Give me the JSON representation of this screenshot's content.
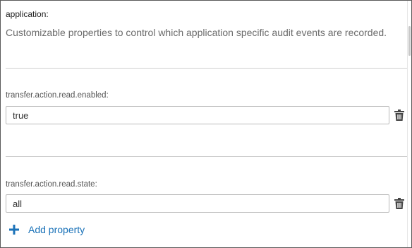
{
  "section": {
    "label": "application:",
    "description": "Customizable properties to control which application specific audit events are recorded."
  },
  "properties": [
    {
      "label": "transfer.action.read.enabled:",
      "value": "true"
    },
    {
      "label": "transfer.action.read.state:",
      "value": "all"
    }
  ],
  "actions": {
    "add_property_label": "Add property"
  },
  "icons": {
    "delete": "trash-icon",
    "add": "plus-icon"
  },
  "colors": {
    "link": "#1a72b8",
    "text": "#3a3a3a",
    "muted": "#6b6b6b",
    "border": "#b9b9b9"
  }
}
